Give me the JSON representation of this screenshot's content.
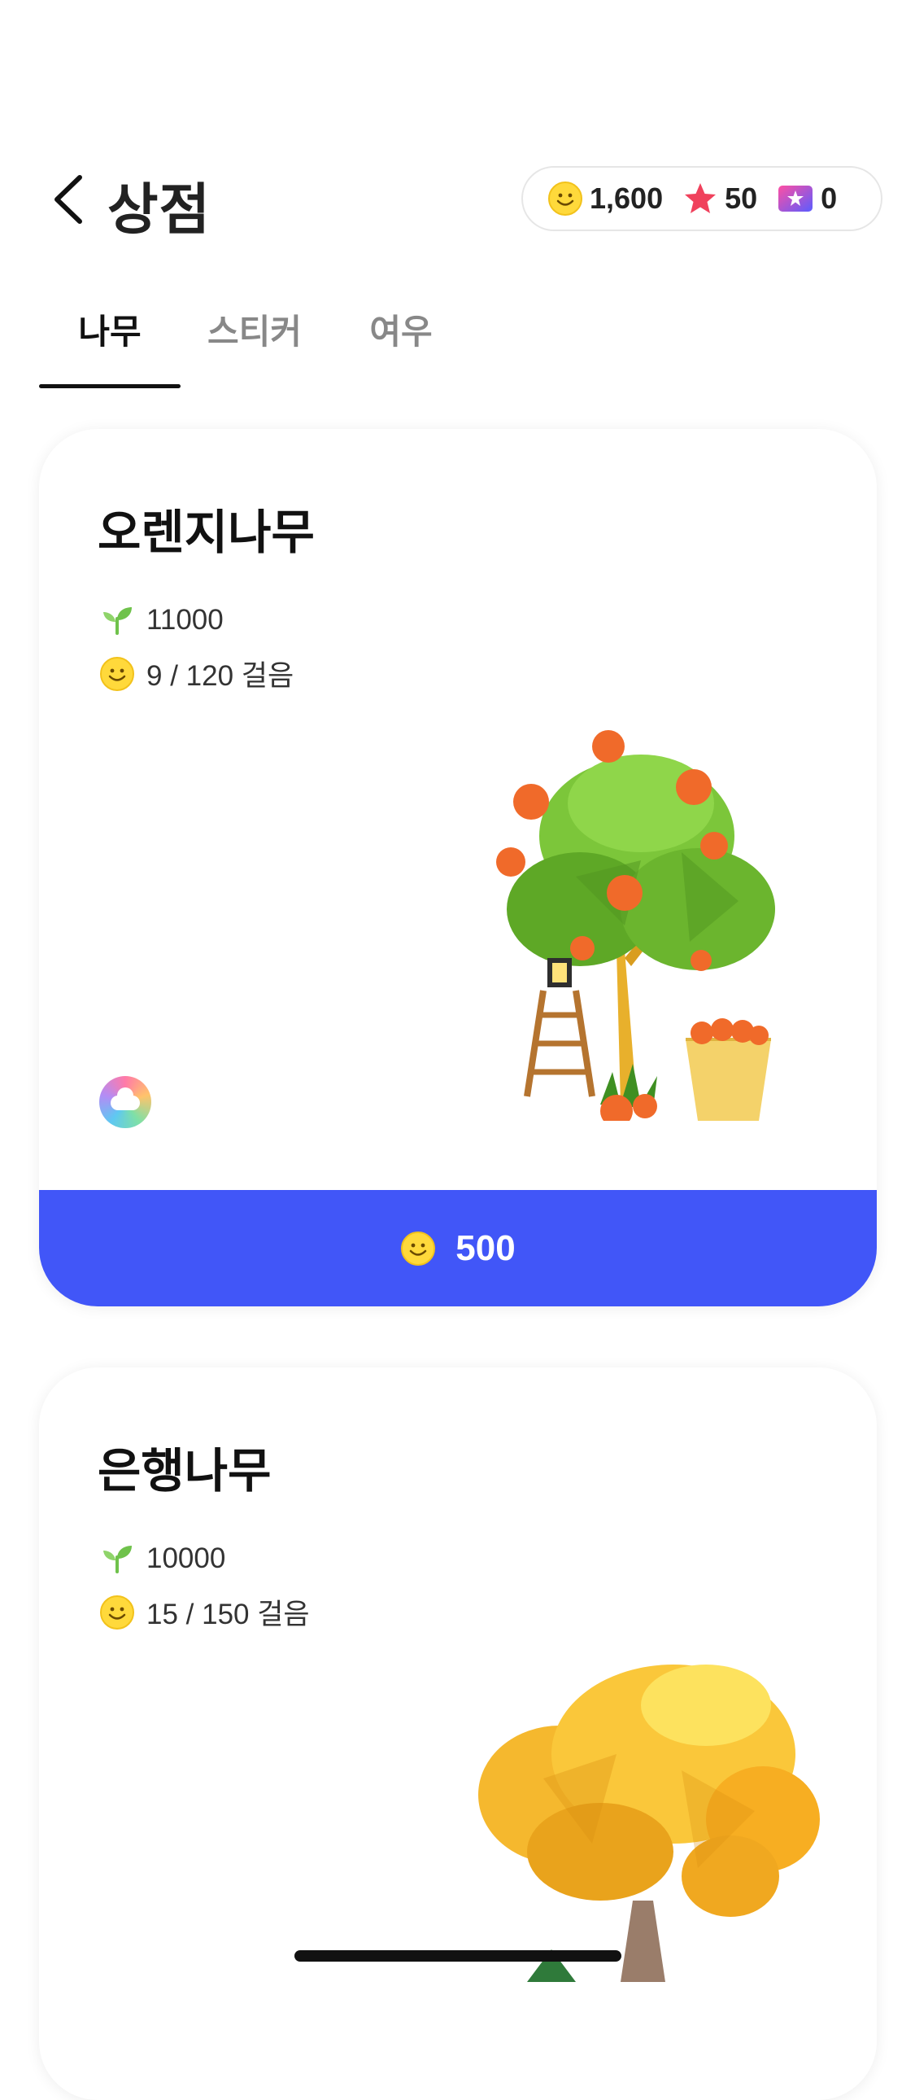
{
  "header": {
    "title": "상점",
    "currencies": [
      {
        "icon": "coin-icon",
        "value": "1,600"
      },
      {
        "icon": "star-icon",
        "value": "50"
      },
      {
        "icon": "ticket-icon",
        "value": "0"
      }
    ]
  },
  "tabs": [
    {
      "label": "나무",
      "active": true
    },
    {
      "label": "스티커",
      "active": false
    },
    {
      "label": "여우",
      "active": false
    }
  ],
  "items": [
    {
      "name": "오렌지나무",
      "sprout_value": "11000",
      "steps_text": "9 / 120 걸음",
      "price": "500",
      "weather_icon": "rainbow-cloud-icon",
      "art": "orange-tree-illustration"
    },
    {
      "name": "은행나무",
      "sprout_value": "10000",
      "steps_text": "15 / 150 걸음",
      "art": "ginkgo-tree-illustration"
    }
  ],
  "colors": {
    "accent": "#4156f8",
    "coin": "#ffd93b",
    "star": "#f0415c",
    "sprout": "#6fc24b"
  }
}
